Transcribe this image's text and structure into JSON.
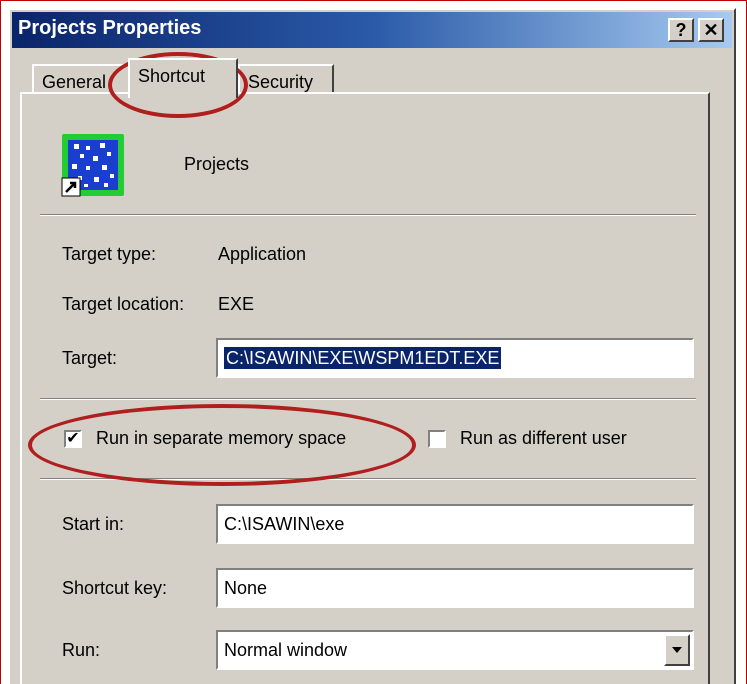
{
  "window": {
    "title": "Projects Properties",
    "help_button": "?",
    "close_button": "✕"
  },
  "tabs": [
    {
      "label": "General"
    },
    {
      "label": "Shortcut",
      "active": true
    },
    {
      "label": "Security"
    }
  ],
  "shortcut": {
    "icon_name": "projects-app-icon",
    "name": "Projects",
    "target_type_label": "Target type:",
    "target_type_value": "Application",
    "target_location_label": "Target location:",
    "target_location_value": "EXE",
    "target_label": "Target:",
    "target_value": "C:\\ISAWIN\\EXE\\WSPM1EDT.EXE",
    "run_separate_label": "Run in separate memory space",
    "run_separate_checked": true,
    "run_as_user_label": "Run as different user",
    "run_as_user_checked": false,
    "start_in_label": "Start in:",
    "start_in_value": "C:\\ISAWIN\\exe",
    "shortcut_key_label": "Shortcut key:",
    "shortcut_key_value": "None",
    "run_label": "Run:",
    "run_value": "Normal window"
  },
  "colors": {
    "titlebar_start": "#0a246a",
    "titlebar_end": "#a6caf0",
    "annotation_red": "#b01e1e",
    "dialog_bg": "#d4d0c8"
  }
}
